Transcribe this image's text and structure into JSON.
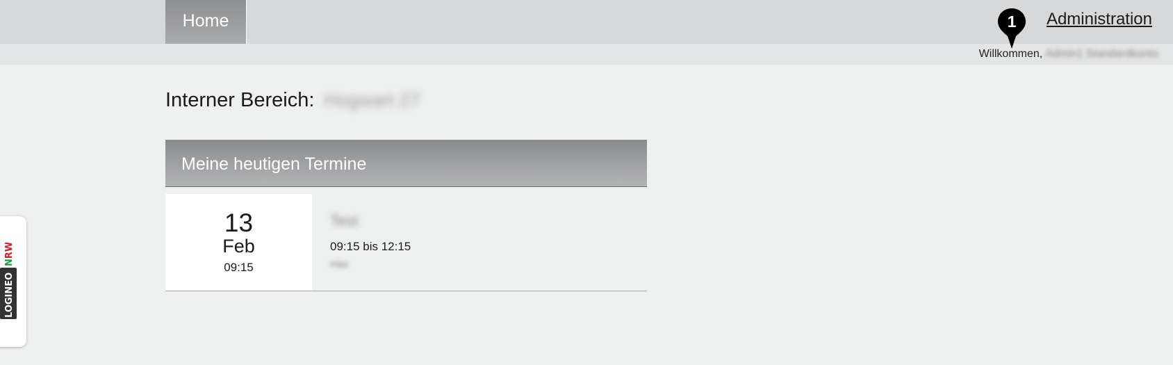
{
  "nav": {
    "home_label": "Home",
    "admin_label": "Administration"
  },
  "marker": {
    "number": "1"
  },
  "subbar": {
    "welcome_label": "Willkommen,",
    "user_name": "Admin1 Standardkonto"
  },
  "main": {
    "title": "Interner Bereich:",
    "title_value": "Hogwart 27"
  },
  "panel": {
    "header": "Meine heutigen Termine",
    "events": [
      {
        "day": "13",
        "month": "Feb",
        "time": "09:15",
        "title": "Test",
        "range": "09:15 bis 12:15",
        "location": "Hier"
      }
    ]
  },
  "side_tab": {
    "logo_text_1": "LOGINEO",
    "logo_text_2": "NRW"
  },
  "colors": {
    "background": "#eff0f0",
    "topbar": "#d7d8d9",
    "header_gradient_top": "#8a8b8d",
    "logo_green": "#1a9b3c",
    "logo_red": "#d21f26",
    "logo_dark": "#333333"
  }
}
